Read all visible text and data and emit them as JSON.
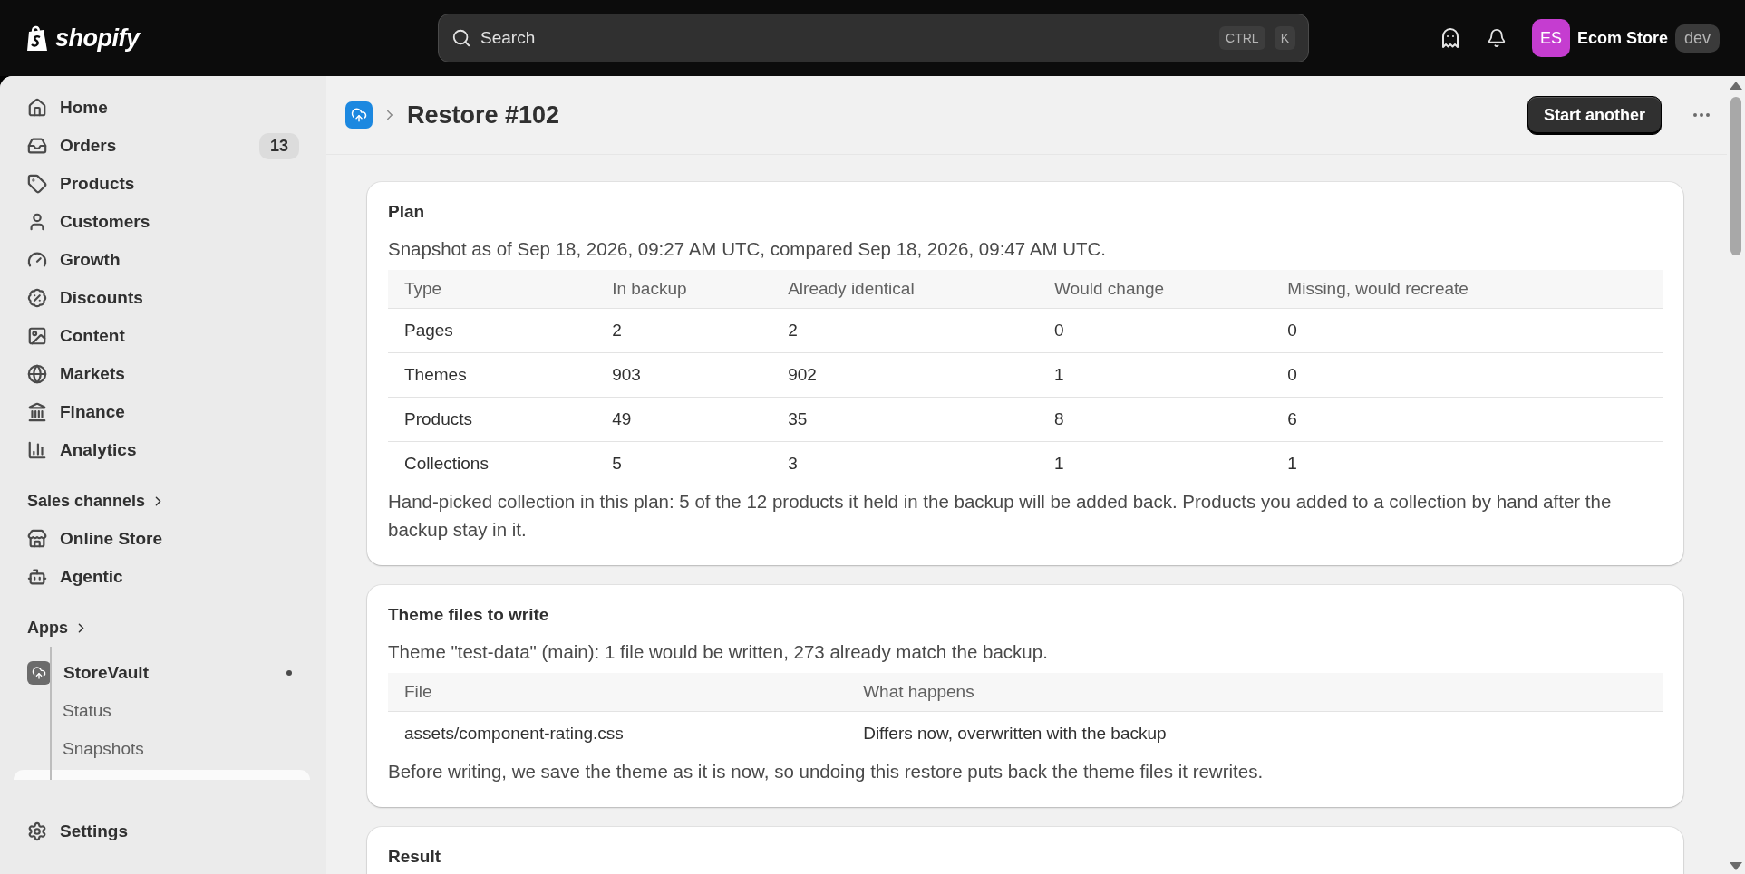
{
  "topbar": {
    "logo": "shopify",
    "search": {
      "placeholder": "Search",
      "keys": [
        "CTRL",
        "K"
      ]
    },
    "store": {
      "initials": "ES",
      "name": "Ecom Store",
      "badge": "dev"
    }
  },
  "sidebar": {
    "items": [
      {
        "label": "Home"
      },
      {
        "label": "Orders",
        "badge": "13"
      },
      {
        "label": "Products"
      },
      {
        "label": "Customers"
      },
      {
        "label": "Growth"
      },
      {
        "label": "Discounts"
      },
      {
        "label": "Content"
      },
      {
        "label": "Markets"
      },
      {
        "label": "Finance"
      },
      {
        "label": "Analytics"
      }
    ],
    "sales_channels": {
      "heading": "Sales channels",
      "items": [
        {
          "label": "Online Store"
        },
        {
          "label": "Agentic"
        }
      ]
    },
    "apps": {
      "heading": "Apps",
      "app": {
        "label": "StoreVault",
        "children": [
          {
            "label": "Status"
          },
          {
            "label": "Snapshots"
          }
        ]
      }
    },
    "settings": {
      "label": "Settings"
    }
  },
  "page": {
    "title": "Restore #102",
    "primary_button": "Start another"
  },
  "cards": [
    {
      "kind": "table",
      "title": "Plan",
      "intro": "Snapshot as of Sep 18, 2026, 09:27 AM UTC, compared Sep 18, 2026, 09:47 AM UTC.",
      "columns": [
        "Type",
        "In backup",
        "Already identical",
        "Would change",
        "Missing, would recreate"
      ],
      "rows": [
        [
          "Pages",
          "2",
          "2",
          "0",
          "0"
        ],
        [
          "Themes",
          "903",
          "902",
          "1",
          "0"
        ],
        [
          "Products",
          "49",
          "35",
          "8",
          "6"
        ],
        [
          "Collections",
          "5",
          "3",
          "1",
          "1"
        ]
      ],
      "note": "Hand-picked collection in this plan: 5 of the 12 products it held in the backup will be added back. Products you added to a collection by hand after the backup stay in it."
    },
    {
      "kind": "table",
      "title": "Theme files to write",
      "intro": "Theme \"test-data\" (main): 1 file would be written, 273 already match the backup.",
      "columns": [
        "File",
        "What happens"
      ],
      "rows": [
        [
          "assets/component-rating.css",
          "Differs now, overwritten with the backup"
        ]
      ],
      "note": "Before writing, we save the theme as it is now, so undoing this restore puts back the theme files it rewrites."
    },
    {
      "kind": "title_only",
      "title": "Result"
    }
  ]
}
